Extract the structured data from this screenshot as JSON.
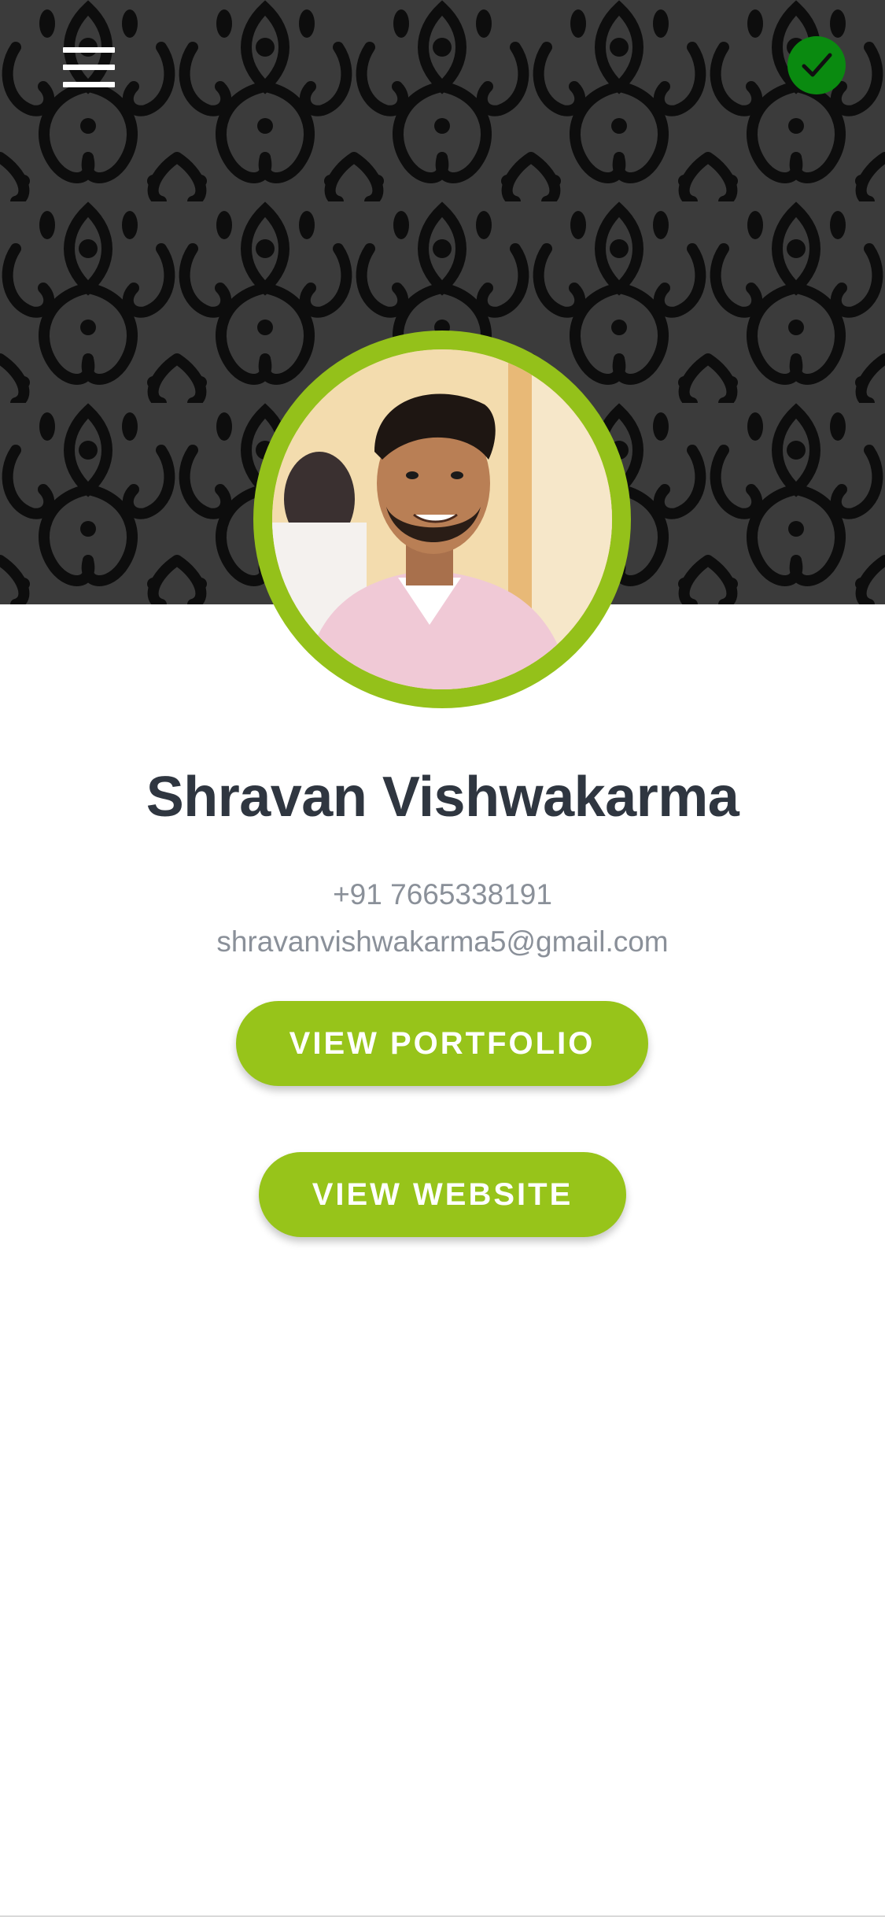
{
  "header": {
    "menu_icon": "hamburger-menu-icon",
    "verified_icon": "check-circle-icon",
    "verified_color": "#0a8a10"
  },
  "profile": {
    "name": "Shravan Vishwakarma",
    "phone": "+91 7665338191",
    "email": "shravanvishwakarma5@gmail.com",
    "ring_color": "#94c11a"
  },
  "actions": {
    "portfolio_label": "VIEW PORTFOLIO",
    "website_label": "VIEW WEBSITE",
    "accent_color": "#97c41a"
  }
}
